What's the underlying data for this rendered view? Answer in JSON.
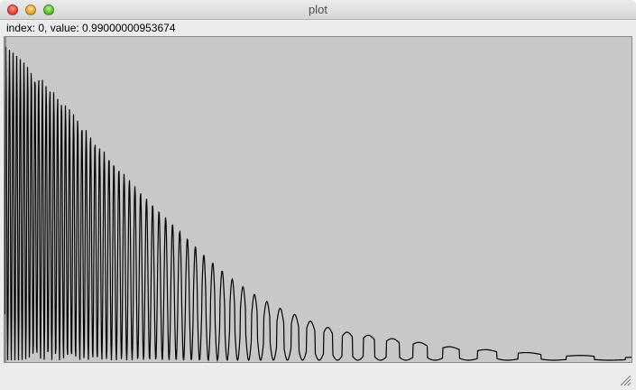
{
  "window": {
    "title": "plot",
    "buttons": {
      "close_icon": "close-icon",
      "minimize_icon": "minimize-icon",
      "zoom_icon": "zoom-icon"
    }
  },
  "status": {
    "text": "index: 0, value: 0.99000000953674"
  },
  "colors": {
    "plot_background": "#c8c8c8",
    "line": "#000000",
    "window_background": "#ececec"
  },
  "chart_data": {
    "type": "line",
    "title": "",
    "xlabel": "",
    "ylabel": "",
    "grid": false,
    "ylim": [
      0,
      1
    ],
    "description_points": [
      {
        "index": 0,
        "value": 0.99
      }
    ],
    "envelope": {
      "x": [
        0,
        25,
        50,
        75,
        100,
        125,
        150,
        175,
        200,
        225,
        250,
        275,
        300,
        325,
        350,
        375,
        400,
        425,
        450,
        475,
        500,
        525,
        550,
        575,
        600,
        625,
        650,
        675,
        697
      ],
      "peak": [
        0.99,
        0.93,
        0.86,
        0.78,
        0.69,
        0.61,
        0.53,
        0.46,
        0.39,
        0.32,
        0.26,
        0.21,
        0.17,
        0.14,
        0.11,
        0.09,
        0.08,
        0.07,
        0.06,
        0.05,
        0.04,
        0.035,
        0.03,
        0.025,
        0.02,
        0.015,
        0.015,
        0.01,
        0.01
      ]
    }
  }
}
